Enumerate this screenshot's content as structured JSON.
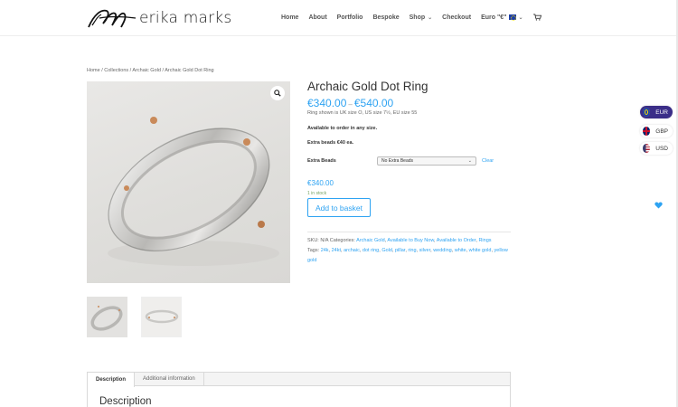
{
  "site": {
    "brand": "erika marks"
  },
  "nav": {
    "items": [
      {
        "label": "Home"
      },
      {
        "label": "About"
      },
      {
        "label": "Portfolio"
      },
      {
        "label": "Bespoke"
      },
      {
        "label": "Shop"
      },
      {
        "label": "Checkout"
      },
      {
        "label": "Euro \"€\""
      }
    ]
  },
  "breadcrumb": "Home / Collections / Archaic Gold / Archaic Gold Dot Ring",
  "product": {
    "title": "Archaic Gold Dot Ring",
    "price_min": "€340.00",
    "price_sep": "–",
    "price_max": "€540.00",
    "size_note": "Ring shown is UK size O, US size 7½, EU size 55",
    "order_note": "Available to order in any size.",
    "beads_note": "Extra beads €40 ea.",
    "variation_label": "Extra Beads",
    "variation_selected": "No Extra Beads",
    "clear_label": "Clear",
    "variation_price": "€340.00",
    "stock": "1 in stock",
    "add_button": "Add to basket",
    "sku_label": "SKU:",
    "sku_value": "N/A",
    "categories_label": "Categories:",
    "categories": [
      "Archaic Gold",
      "Available to Buy Now",
      "Available to Order",
      "Rings"
    ],
    "tags_label": "Tags:",
    "tags": [
      "24k",
      "24kt",
      "archaic",
      "dot ring",
      "Gold",
      "pillar",
      "ring",
      "silver",
      "wedding",
      "white",
      "white gold",
      "yellow gold"
    ]
  },
  "currency_switcher": {
    "options": [
      {
        "code": "EUR"
      },
      {
        "code": "GBP"
      },
      {
        "code": "USD"
      }
    ]
  },
  "tabs": {
    "items": [
      {
        "label": "Description"
      },
      {
        "label": "Additional information"
      }
    ],
    "active_heading": "Description"
  },
  "colors": {
    "accent": "#2ea3f2",
    "stock_green": "#77a464",
    "eur_pill": "#3b2e88"
  },
  "icons": [
    "search-icon",
    "cart-icon",
    "chevron-down-icon",
    "heart-icon",
    "eu-flag-icon",
    "uk-flag-icon",
    "us-flag-icon"
  ]
}
